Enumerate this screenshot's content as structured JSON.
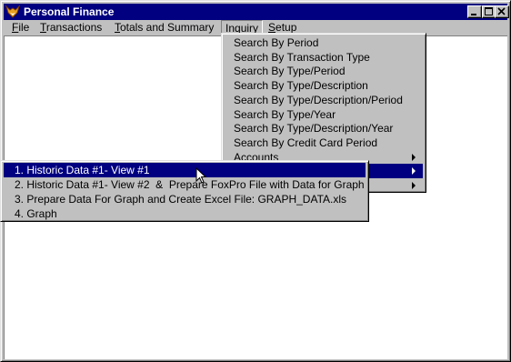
{
  "window": {
    "title": "Personal Finance"
  },
  "menubar": {
    "items": [
      {
        "label_u": "F",
        "label_rest": "ile"
      },
      {
        "label_u": "T",
        "label_rest": "ransactions"
      },
      {
        "label_u": "T",
        "label_rest": "otals and Summary"
      },
      {
        "label_u": "I",
        "label_rest": "nquiry"
      },
      {
        "label_u": "S",
        "label_rest": "etup"
      }
    ]
  },
  "inquiry_menu": {
    "items": [
      {
        "label": "Search By Period"
      },
      {
        "label": "Search By Transaction Type"
      },
      {
        "label": "Search By Type/Period"
      },
      {
        "label": "Search By Type/Description"
      },
      {
        "label": "Search By Type/Description/Period"
      },
      {
        "label": "Search By Type/Year"
      },
      {
        "label": "Search By Type/Description/Year"
      },
      {
        "label": "Search By Credit Card Period"
      },
      {
        "label": "Accounts"
      },
      {
        "label": ""
      },
      {
        "label": ""
      }
    ]
  },
  "submenu": {
    "items": [
      {
        "label": "1. Historic Data #1- View #1"
      },
      {
        "label": "2. Historic Data #1- View #2  &  Prepare FoxPro File with Data for Graph"
      },
      {
        "label": "3. Prepare Data For Graph and Create Excel File: GRAPH_DATA.xls"
      },
      {
        "label": "4. Graph"
      }
    ]
  },
  "colors": {
    "titlebar": "#000080",
    "highlight": "#000080",
    "face": "#c0c0c0"
  }
}
